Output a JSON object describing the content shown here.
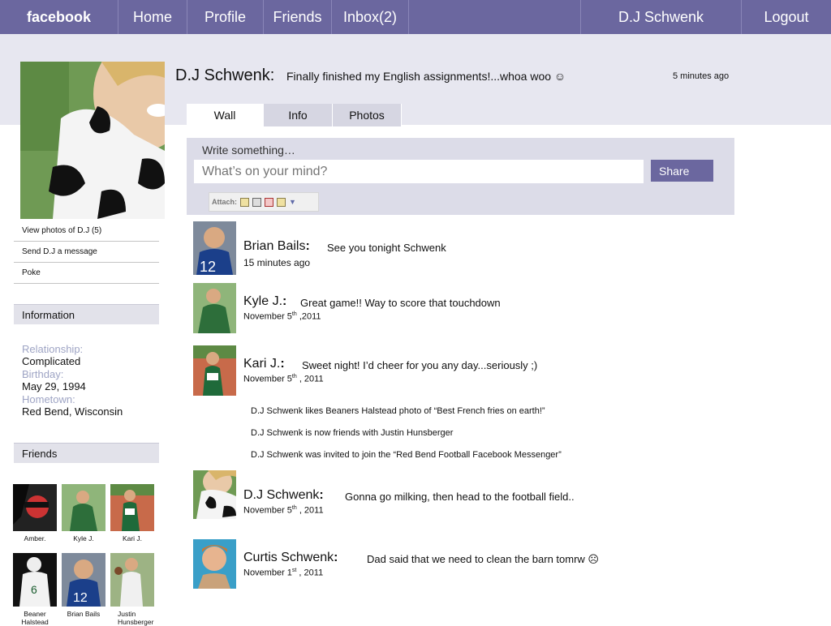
{
  "topbar": {
    "brand": "facebook",
    "home": "Home",
    "profile": "Profile",
    "friends": "Friends",
    "inbox": "Inbox(2)",
    "user": "D.J Schwenk",
    "logout": "Logout"
  },
  "status": {
    "name": "D.J Schwenk:",
    "text": "Finally finished my English assignments!...whoa woo ☺",
    "time": "5 minutes ago"
  },
  "sidebar": {
    "links": [
      "View photos of D.J (5)",
      "Send  D.J a message",
      "Poke"
    ],
    "information_title": "Information",
    "info": {
      "relationship_label": "Relationship:",
      "relationship": "Complicated",
      "birthday_label": "Birthday:",
      "birthday": "May 29, 1994",
      "hometown_label": "Hometown:",
      "hometown": "Red Bend, Wisconsin"
    },
    "friends_title": "Friends",
    "friends": [
      "Amber.",
      "Kyle  J.",
      "Kari  J.",
      "Beaner Halstead",
      "Brian Bails",
      "Justin Hunsberger"
    ]
  },
  "tabs": [
    "Wall",
    "Info",
    "Photos"
  ],
  "composer": {
    "label": "Write something…",
    "placeholder": "What’s on your mind?",
    "share": "Share",
    "attach": "Attach:"
  },
  "posts": [
    {
      "name": "Brian Bails",
      "sep": ":",
      "msg": "See you tonight Schwenk",
      "date": "15 minutes ago"
    },
    {
      "name": "Kyle J.",
      "sep": ":",
      "msg": "Great game!! Way to score that touchdown",
      "date_main": "November 5",
      "date_sup": "th",
      "date_rest": " ,2011"
    },
    {
      "name": "Kari J.",
      "sep": ":",
      "msg": "Sweet night! I’d cheer for you any day...seriously ;)",
      "date_main": "November 5",
      "date_sup": "th",
      "date_rest": " , 2011"
    },
    {
      "name": "D.J Schwenk",
      "sep": ":",
      "msg": "Gonna go milking, then head to the football field..",
      "date_main": "November 5",
      "date_sup": "th",
      "date_rest": " , 2011"
    },
    {
      "name": "Curtis Schwenk",
      "sep": ":",
      "msg": "Dad said that we need to clean the barn tomrw ☹",
      "date_main": "November 1",
      "date_sup": "st",
      "date_rest": " , 2011"
    }
  ],
  "activity": [
    "D.J Schwenk likes Beaners Halstead photo of “Best French fries on earth!”",
    "D.J Schwenk is now friends with  Justin Hunsberger",
    "D.J Schwenk was invited to join the “Red Bend Football Facebook Messenger”"
  ]
}
